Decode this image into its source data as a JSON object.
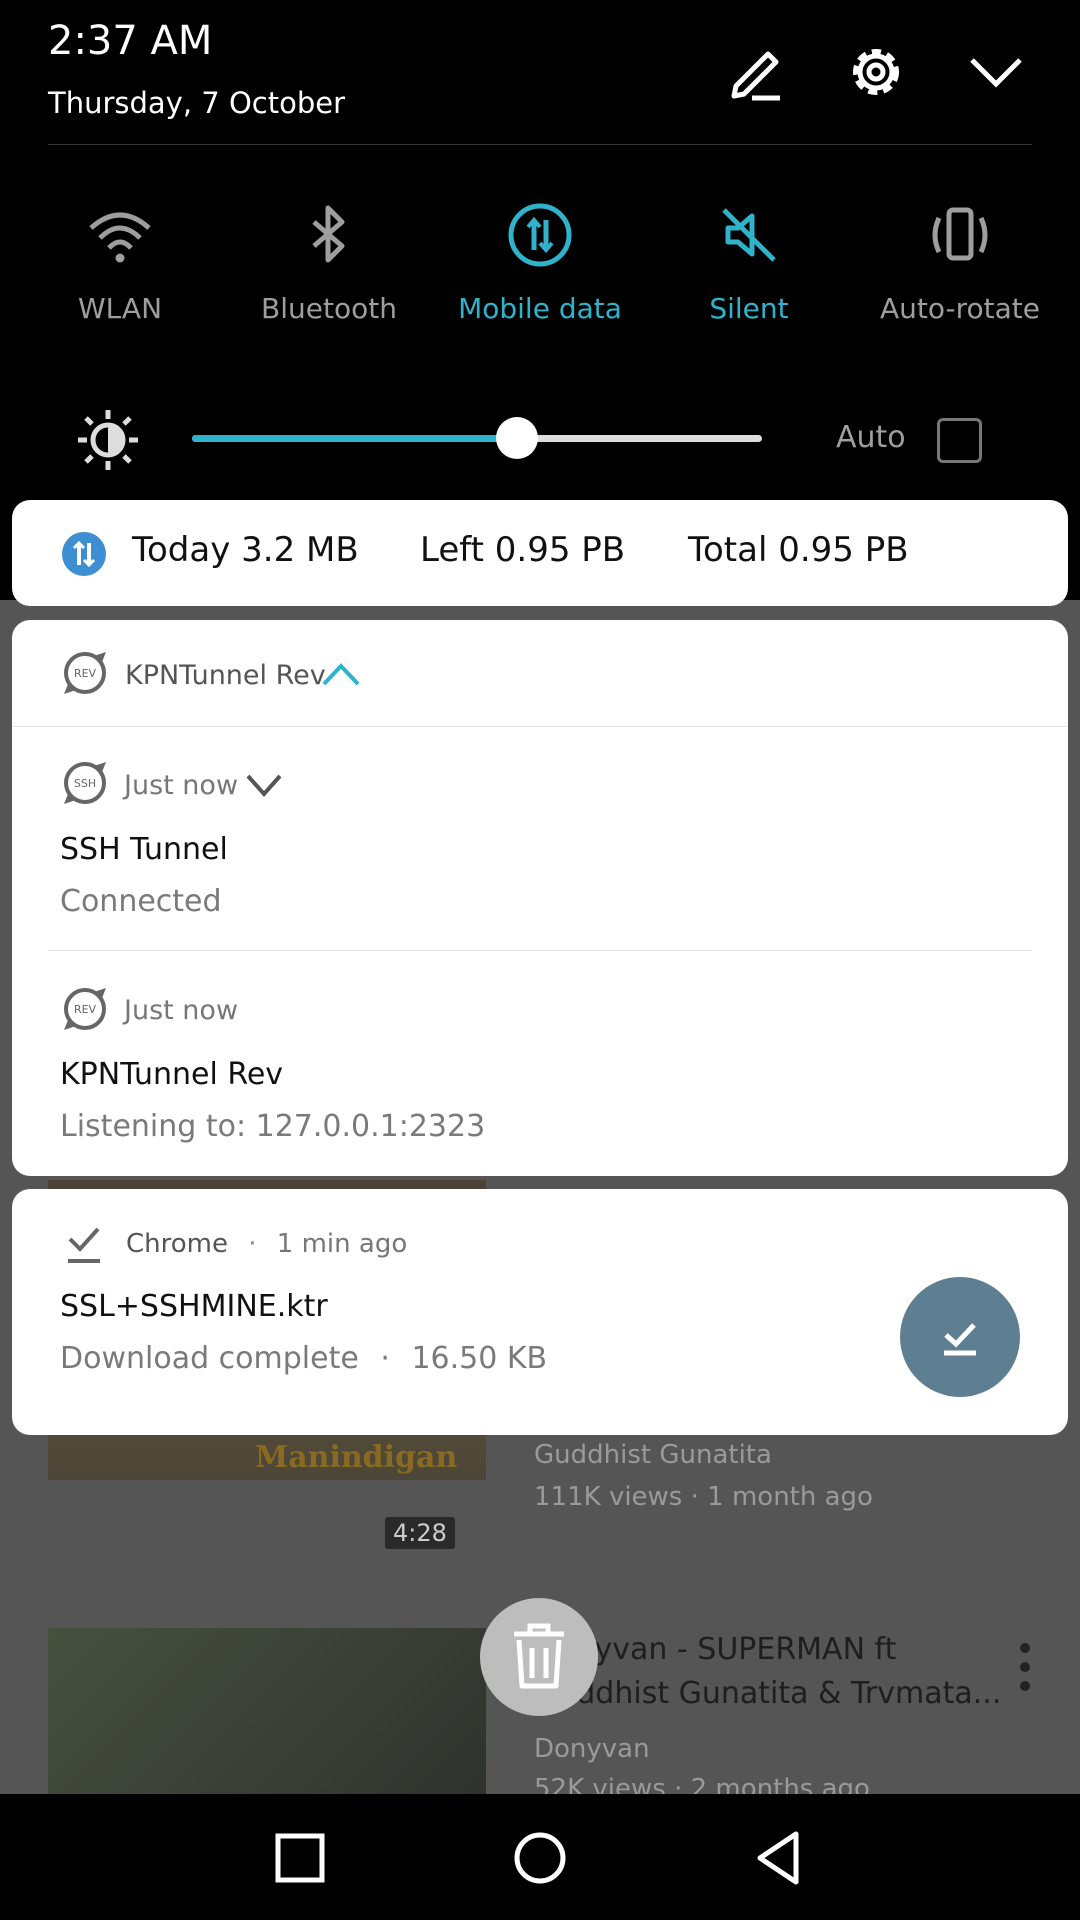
{
  "status": {
    "time": "2:37 AM",
    "date": "Thursday, 7 October"
  },
  "header_icons": [
    "pencil-icon",
    "gear-icon",
    "chevron-down-icon"
  ],
  "toggles": [
    {
      "label": "WLAN",
      "icon": "wifi-icon",
      "active": false
    },
    {
      "label": "Bluetooth",
      "icon": "bluetooth-icon",
      "active": false
    },
    {
      "label": "Mobile data",
      "icon": "mobile-data-icon",
      "active": true
    },
    {
      "label": "Silent",
      "icon": "silent-icon",
      "active": true
    },
    {
      "label": "Auto-rotate",
      "icon": "auto-rotate-icon",
      "active": false
    }
  ],
  "brightness": {
    "level": 0.57,
    "auto_label": "Auto",
    "auto_checked": false
  },
  "data_usage": {
    "today": "Today 3.2 MB",
    "left": "Left 0.95 PB",
    "total": "Total 0.95 PB"
  },
  "kpn_group": {
    "app_name": "KPNTunnel Rev",
    "notifications": [
      {
        "time": "Just now",
        "title": "SSH Tunnel",
        "text": "Connected",
        "logo_text": "SSH"
      },
      {
        "time": "Just now",
        "title": "KPNTunnel Rev",
        "text": "Listening to: 127.0.0.1:2323",
        "logo_text": "REV"
      }
    ],
    "logo_text": "REV"
  },
  "chrome_notification": {
    "app": "Chrome",
    "separator": "·",
    "time": "1 min ago",
    "title": "SSL+SSHMINE.ktr",
    "status": "Download complete",
    "size": "16.50 KB"
  },
  "background": {
    "thumb_title": "Manindigan",
    "duration": "4:28",
    "video1": {
      "channel": "Guddhist Gunatita",
      "meta": "111K views · 1 month ago"
    },
    "video2": {
      "title_line1": "Donyvan - SUPERMAN ft",
      "title_line2": "Guddhist Gunatita & Trvmata...",
      "channel": "Donyvan",
      "meta": "52K views · 2 months ago"
    }
  },
  "colors": {
    "accent": "#2fb3cc",
    "fab": "#5d7f91"
  }
}
